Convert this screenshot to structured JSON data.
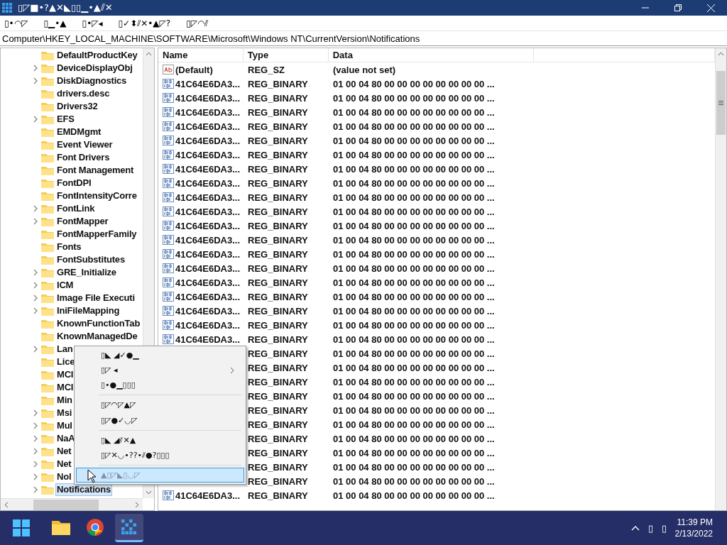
{
  "window": {
    "title": "▯◸■•?▲✕◣▯▯▁•▲⫽✕"
  },
  "menu_bar": [
    "▯•◠◸",
    "▯▁•▲",
    "▯•◸◂",
    "▯✓⬍⫽✕•▲◸?",
    "▯◸◠⫽"
  ],
  "address": "Computer\\HKEY_LOCAL_MACHINE\\SOFTWARE\\Microsoft\\Windows NT\\CurrentVersion\\Notifications",
  "tree": {
    "items": [
      {
        "label": "DefaultProductKey",
        "expandable": false,
        "selected": false
      },
      {
        "label": "DeviceDisplayObj",
        "expandable": true,
        "selected": false
      },
      {
        "label": "DiskDiagnostics",
        "expandable": true,
        "selected": false
      },
      {
        "label": "drivers.desc",
        "expandable": false,
        "selected": false
      },
      {
        "label": "Drivers32",
        "expandable": false,
        "selected": false
      },
      {
        "label": "EFS",
        "expandable": true,
        "selected": false
      },
      {
        "label": "EMDMgmt",
        "expandable": false,
        "selected": false
      },
      {
        "label": "Event Viewer",
        "expandable": false,
        "selected": false
      },
      {
        "label": "Font Drivers",
        "expandable": false,
        "selected": false
      },
      {
        "label": "Font Management",
        "expandable": false,
        "selected": false
      },
      {
        "label": "FontDPI",
        "expandable": false,
        "selected": false
      },
      {
        "label": "FontIntensityCorre",
        "expandable": false,
        "selected": false
      },
      {
        "label": "FontLink",
        "expandable": true,
        "selected": false
      },
      {
        "label": "FontMapper",
        "expandable": true,
        "selected": false
      },
      {
        "label": "FontMapperFamily",
        "expandable": false,
        "selected": false
      },
      {
        "label": "Fonts",
        "expandable": false,
        "selected": false
      },
      {
        "label": "FontSubstitutes",
        "expandable": false,
        "selected": false
      },
      {
        "label": "GRE_Initialize",
        "expandable": true,
        "selected": false
      },
      {
        "label": "ICM",
        "expandable": true,
        "selected": false
      },
      {
        "label": "Image File Executi",
        "expandable": true,
        "selected": false
      },
      {
        "label": "IniFileMapping",
        "expandable": true,
        "selected": false
      },
      {
        "label": "KnownFunctionTab",
        "expandable": false,
        "selected": false
      },
      {
        "label": "KnownManagedDe",
        "expandable": false,
        "selected": false
      },
      {
        "label": "Lan",
        "expandable": true,
        "selected": false
      },
      {
        "label": "Lice",
        "expandable": false,
        "selected": false
      },
      {
        "label": "MCI",
        "expandable": false,
        "selected": false
      },
      {
        "label": "MCI",
        "expandable": false,
        "selected": false
      },
      {
        "label": "Min",
        "expandable": false,
        "selected": false
      },
      {
        "label": "Msi",
        "expandable": true,
        "selected": false
      },
      {
        "label": "Mul",
        "expandable": true,
        "selected": false
      },
      {
        "label": "NaA",
        "expandable": true,
        "selected": false
      },
      {
        "label": "Net",
        "expandable": true,
        "selected": false
      },
      {
        "label": "Net",
        "expandable": true,
        "selected": false
      },
      {
        "label": "Nol",
        "expandable": true,
        "selected": false
      },
      {
        "label": "Notifications",
        "expandable": true,
        "selected": true
      }
    ]
  },
  "values": {
    "columns": [
      "Name",
      "Type",
      "Data"
    ],
    "rows": [
      {
        "kind": "string",
        "name": "(Default)",
        "type": "REG_SZ",
        "data": "(value not set)"
      },
      {
        "kind": "binary",
        "name": "41C64E6DA3...",
        "type": "REG_BINARY",
        "data": "01 00 04 80 00 00 00 00 00 00 00 00 ..."
      },
      {
        "kind": "binary",
        "name": "41C64E6DA3...",
        "type": "REG_BINARY",
        "data": "01 00 04 80 00 00 00 00 00 00 00 00 ..."
      },
      {
        "kind": "binary",
        "name": "41C64E6DA3...",
        "type": "REG_BINARY",
        "data": "01 00 04 80 00 00 00 00 00 00 00 00 ..."
      },
      {
        "kind": "binary",
        "name": "41C64E6DA3...",
        "type": "REG_BINARY",
        "data": "01 00 04 80 00 00 00 00 00 00 00 00 ..."
      },
      {
        "kind": "binary",
        "name": "41C64E6DA3...",
        "type": "REG_BINARY",
        "data": "01 00 04 80 00 00 00 00 00 00 00 00 ..."
      },
      {
        "kind": "binary",
        "name": "41C64E6DA3...",
        "type": "REG_BINARY",
        "data": "01 00 04 80 00 00 00 00 00 00 00 00 ..."
      },
      {
        "kind": "binary",
        "name": "41C64E6DA3...",
        "type": "REG_BINARY",
        "data": "01 00 04 80 00 00 00 00 00 00 00 00 ..."
      },
      {
        "kind": "binary",
        "name": "41C64E6DA3...",
        "type": "REG_BINARY",
        "data": "01 00 04 80 00 00 00 00 00 00 00 00 ..."
      },
      {
        "kind": "binary",
        "name": "41C64E6DA3...",
        "type": "REG_BINARY",
        "data": "01 00 04 80 00 00 00 00 00 00 00 00 ..."
      },
      {
        "kind": "binary",
        "name": "41C64E6DA3...",
        "type": "REG_BINARY",
        "data": "01 00 04 80 00 00 00 00 00 00 00 00 ..."
      },
      {
        "kind": "binary",
        "name": "41C64E6DA3...",
        "type": "REG_BINARY",
        "data": "01 00 04 80 00 00 00 00 00 00 00 00 ..."
      },
      {
        "kind": "binary",
        "name": "41C64E6DA3...",
        "type": "REG_BINARY",
        "data": "01 00 04 80 00 00 00 00 00 00 00 00 ..."
      },
      {
        "kind": "binary",
        "name": "41C64E6DA3...",
        "type": "REG_BINARY",
        "data": "01 00 04 80 00 00 00 00 00 00 00 00 ..."
      },
      {
        "kind": "binary",
        "name": "41C64E6DA3...",
        "type": "REG_BINARY",
        "data": "01 00 04 80 00 00 00 00 00 00 00 00 ..."
      },
      {
        "kind": "binary",
        "name": "41C64E6DA3...",
        "type": "REG_BINARY",
        "data": "01 00 04 80 00 00 00 00 00 00 00 00 ..."
      },
      {
        "kind": "binary",
        "name": "41C64E6DA3...",
        "type": "REG_BINARY",
        "data": "01 00 04 80 00 00 00 00 00 00 00 00 ..."
      },
      {
        "kind": "binary",
        "name": "41C64E6DA3...",
        "type": "REG_BINARY",
        "data": "01 00 04 80 00 00 00 00 00 00 00 00 ..."
      },
      {
        "kind": "binary",
        "name": "41C64E6DA3...",
        "type": "REG_BINARY",
        "data": "01 00 04 80 00 00 00 00 00 00 00 00 ..."
      },
      {
        "kind": "binary",
        "name": "41C64E6DA3...",
        "type": "REG_BINARY",
        "data": "01 00 04 80 00 00 00 00 00 00 00 00 ..."
      },
      {
        "type": "REG_BINARY",
        "data": "01 00 04 80 00 00 00 00 00 00 00 00 ..."
      },
      {
        "type": "REG_BINARY",
        "data": "01 00 04 80 00 00 00 00 00 00 00 00 ..."
      },
      {
        "type": "REG_BINARY",
        "data": "01 00 04 80 00 00 00 00 00 00 00 00 ..."
      },
      {
        "type": "REG_BINARY",
        "data": "01 00 04 80 00 00 00 00 00 00 00 00 ..."
      },
      {
        "type": "REG_BINARY",
        "data": "01 00 04 80 00 00 00 00 00 00 00 00 ..."
      },
      {
        "type": "REG_BINARY",
        "data": "01 00 04 80 00 00 00 00 00 00 00 00 ..."
      },
      {
        "type": "REG_BINARY",
        "data": "01 00 04 80 00 00 00 00 00 00 00 00 ..."
      },
      {
        "type": "REG_BINARY",
        "data": "01 00 04 80 00 00 00 00 00 00 00 00 ..."
      },
      {
        "type": "REG_BINARY",
        "data": "01 00 04 80 00 00 00 00 00 00 00 00 ..."
      },
      {
        "type": "REG_BINARY",
        "data": "01 00 04 80 00 00 00 00 00 00 00 00 ..."
      },
      {
        "kind": "binary",
        "name": "41C64E6DA3...",
        "type": "REG_BINARY",
        "data": "01 00 04 80 00 00 00 00 00 00 00 00 ..."
      }
    ]
  },
  "context_menu": {
    "items": [
      {
        "kind": "command",
        "label": "▯◣ ◢✓●▁",
        "selected": false,
        "disabled": false
      },
      {
        "kind": "submenu",
        "label": "▯◸ ◂",
        "selected": false,
        "disabled": false
      },
      {
        "kind": "command",
        "label": "▯•●▁▯▯▯",
        "selected": false,
        "disabled": false
      },
      {
        "kind": "separator"
      },
      {
        "kind": "command",
        "label": "▯◸◠◸▲◸",
        "selected": false,
        "disabled": false
      },
      {
        "kind": "command",
        "label": "▯◸●✓◡◸",
        "selected": false,
        "disabled": false
      },
      {
        "kind": "separator"
      },
      {
        "kind": "command",
        "label": "▯◣ ◢⫽✕▲",
        "selected": false,
        "disabled": false
      },
      {
        "kind": "command",
        "label": "▯◸✕◡•??•⫽●?▯▯▯",
        "selected": false,
        "disabled": false
      },
      {
        "kind": "separator"
      },
      {
        "kind": "command",
        "label": "▲▯◸◣▯◡◸",
        "selected": true,
        "disabled": true
      }
    ]
  },
  "taskbar": {
    "apps": [
      {
        "kind": "explorer",
        "selected": false
      },
      {
        "kind": "browser",
        "selected": false
      },
      {
        "kind": "regedit",
        "selected": true
      }
    ],
    "tray": [
      "▯",
      "▯"
    ],
    "time": "11:39 PM",
    "date": "2/13/2022"
  }
}
